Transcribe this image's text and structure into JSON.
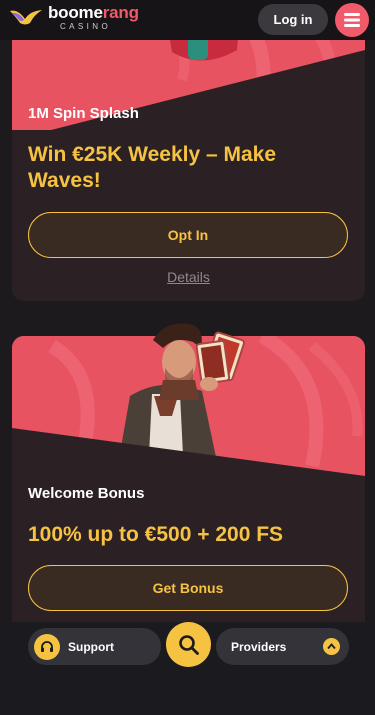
{
  "header": {
    "logo_word_prefix": "boome",
    "logo_word_accent": "rang",
    "logo_sub": "CASINO",
    "login_label": "Log in",
    "menu_icon": "hamburger-icon"
  },
  "promos": [
    {
      "title": "1M Spin Splash",
      "headline": "Win €25K Weekly – Make Waves!",
      "cta_label": "Opt In",
      "details_label": "Details"
    },
    {
      "title": "Welcome Bonus",
      "headline": "100% up to €500 + 200 FS",
      "cta_label": "Get Bonus"
    }
  ],
  "bottom_bar": {
    "support_label": "Support",
    "support_icon": "headset-icon",
    "search_icon": "search-icon",
    "providers_label": "Providers",
    "providers_icon": "chevron-up-icon"
  },
  "colors": {
    "accent": "#f05a6a",
    "gold": "#f6c242",
    "card_bg": "#2b2124",
    "banner_red": "#e85362",
    "page_bg": "#1c1a1c"
  }
}
